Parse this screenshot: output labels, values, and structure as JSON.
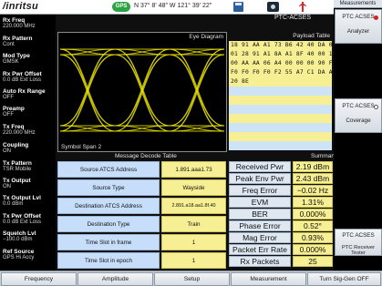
{
  "header": {
    "logo": "/inritsu",
    "gps_badge": "GPS",
    "coordinates": "N 37° 8' 48\" W 121° 39' 22\""
  },
  "main": {
    "mode_label": "PTC-ACSES",
    "eye_title": "Eye Diagram",
    "eye_subtitle": "Symbol Span 2",
    "payload_title": "Payload Table",
    "payload_rows": [
      "18 91 AA A1 73 B6 42 40 DA 00 61 01",
      "01 28 91 A1 8A A1 8F 40 00 19 00 01",
      "00 AA AA 06 A4 00 00 00 90 F0 F0 F0",
      "F0 F0 F0 F0 F2 55 A7 C1 DA AE CE 3B",
      "20 8E",
      "",
      "",
      "",
      "",
      "",
      "",
      "",
      ""
    ],
    "decode_title": "Message Decode Table",
    "summary_title": "Summary",
    "decode_rows": [
      {
        "label": "Source ATCS Address",
        "value": "1.891.aaa1.73"
      },
      {
        "label": "Source Type",
        "value": "Wayside"
      },
      {
        "label": "Destination ATCS Address",
        "value": "2.891.a18.aa1.8f.40"
      },
      {
        "label": "Destination Type",
        "value": "Train"
      },
      {
        "label": "Time Slot in frame",
        "value": "1"
      },
      {
        "label": "Time Slot in epoch",
        "value": "1"
      }
    ],
    "summary_rows": [
      {
        "label": "Received Pwr",
        "value": "2.19 dBm"
      },
      {
        "label": "Peak Env Pwr",
        "value": "2.43 dBm"
      },
      {
        "label": "Freq Error",
        "value": "−0.02 Hz"
      },
      {
        "label": "EVM",
        "value": "1.31%"
      },
      {
        "label": "BER",
        "value": "0.000%"
      },
      {
        "label": "Phase Error",
        "value": "0.52°"
      },
      {
        "label": "Mag Error",
        "value": "0.93%"
      },
      {
        "label": "Packet Err Rate",
        "value": "0.000%"
      },
      {
        "label": "Rx Packets",
        "value": "25"
      }
    ]
  },
  "left_params": [
    {
      "label": "Rx Freq",
      "value": "220.000 MHz"
    },
    {
      "label": "Rx Pattern",
      "value": "Cont"
    },
    {
      "label": "Mod Type",
      "value": "GMSK"
    },
    {
      "label": "Rx Pwr Offset",
      "value": "0.0 dB Ext Loss"
    },
    {
      "label": "Auto Rx Range",
      "value": "OFF"
    },
    {
      "label": "Preamp",
      "value": "OFF"
    },
    {
      "label": "Tx Freq",
      "value": "220.000 MHz"
    },
    {
      "label": "Coupling",
      "value": "ON"
    },
    {
      "label": "Tx Pattern",
      "value": "TSR Mobile"
    },
    {
      "label": "Tx Output",
      "value": "ON"
    },
    {
      "label": "Tx Output Lvl",
      "value": "0.0 dBm"
    },
    {
      "label": "Tx Pwr Offset",
      "value": "0.0 dB Ext Loss"
    },
    {
      "label": "Squelch Lvl",
      "value": "−100.0 dBm"
    },
    {
      "label": "Ref Source",
      "value": "GPS Hi Accy"
    }
  ],
  "right_menu": {
    "title": "Measurements",
    "keys": [
      {
        "line1": "PTC ACSES",
        "line2": "Analyzer"
      },
      {
        "line1": "PTC ACSES",
        "line2": "Coverage"
      },
      {
        "line1": "PTC ACSES",
        "line2": "PTC Receiver Tester"
      }
    ]
  },
  "bottom_keys": [
    "Frequency",
    "Amplitude",
    "Setup",
    "Measurement",
    "Turn Sig-Gen OFF"
  ],
  "colors": {
    "eye_trace": "#e8e000",
    "table_highlight": "#f6ef93",
    "table_label_bg": "#c7defa",
    "active_indicator": "#d82020",
    "gps_badge": "#2da441"
  }
}
